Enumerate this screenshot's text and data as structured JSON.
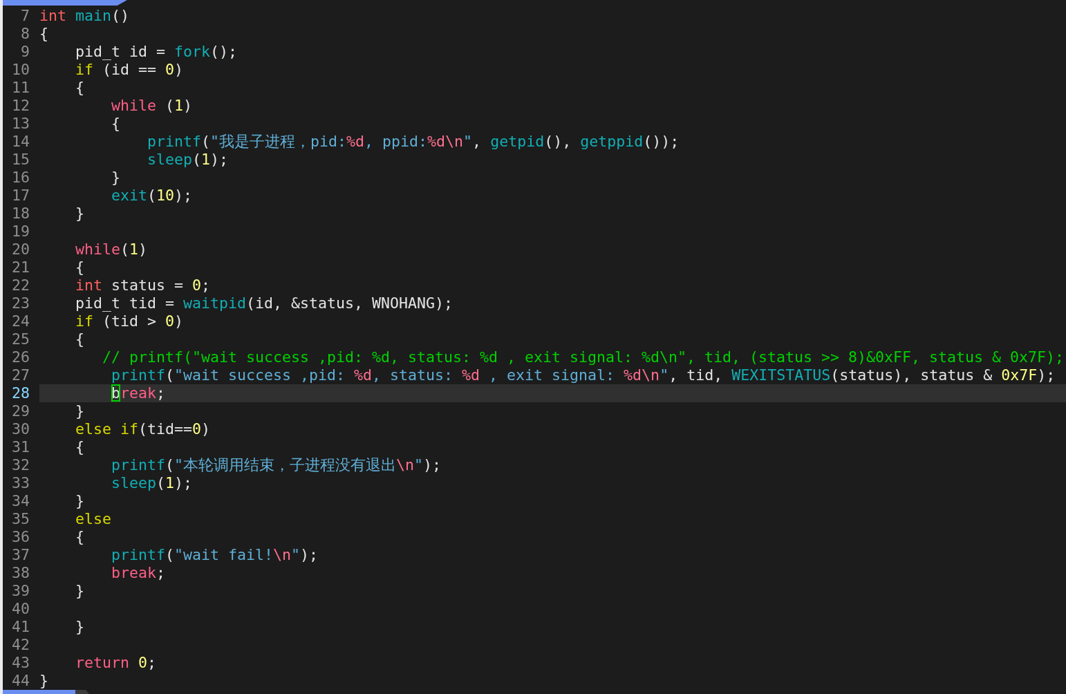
{
  "tabline": {
    "tab": {
      "selected": true
    }
  },
  "lines": [
    {
      "number": "7",
      "current": false,
      "tokens": [
        {
          "kind": "type",
          "text": "int "
        },
        {
          "kind": "func",
          "text": "main"
        },
        {
          "kind": "plain",
          "text": "()"
        }
      ]
    },
    {
      "number": "8",
      "current": false,
      "tokens": [
        {
          "kind": "plain",
          "text": "{"
        }
      ]
    },
    {
      "number": "9",
      "current": false,
      "tokens": [
        {
          "kind": "plain",
          "text": "    pid_t id = "
        },
        {
          "kind": "func",
          "text": "fork"
        },
        {
          "kind": "plain",
          "text": "();"
        }
      ]
    },
    {
      "number": "10",
      "current": false,
      "tokens": [
        {
          "kind": "cond",
          "text": "    if"
        },
        {
          "kind": "plain",
          "text": " (id == "
        },
        {
          "kind": "num",
          "text": "0"
        },
        {
          "kind": "plain",
          "text": ")"
        }
      ]
    },
    {
      "number": "11",
      "current": false,
      "tokens": [
        {
          "kind": "plain",
          "text": "    {"
        }
      ]
    },
    {
      "number": "12",
      "current": false,
      "tokens": [
        {
          "kind": "flow",
          "text": "        while"
        },
        {
          "kind": "plain",
          "text": " ("
        },
        {
          "kind": "num",
          "text": "1"
        },
        {
          "kind": "plain",
          "text": ")"
        }
      ]
    },
    {
      "number": "13",
      "current": false,
      "tokens": [
        {
          "kind": "plain",
          "text": "        {"
        }
      ]
    },
    {
      "number": "14",
      "current": false,
      "tokens": [
        {
          "kind": "func",
          "text": "            printf"
        },
        {
          "kind": "plain",
          "text": "("
        },
        {
          "kind": "str",
          "text": "\"我是子进程，pid:"
        },
        {
          "kind": "fmt",
          "text": "%d"
        },
        {
          "kind": "str",
          "text": ", ppid:"
        },
        {
          "kind": "fmt",
          "text": "%d\\n"
        },
        {
          "kind": "str",
          "text": "\""
        },
        {
          "kind": "plain",
          "text": ", "
        },
        {
          "kind": "func",
          "text": "getpid"
        },
        {
          "kind": "plain",
          "text": "(), "
        },
        {
          "kind": "func",
          "text": "getppid"
        },
        {
          "kind": "plain",
          "text": "());"
        }
      ]
    },
    {
      "number": "15",
      "current": false,
      "tokens": [
        {
          "kind": "func",
          "text": "            sleep"
        },
        {
          "kind": "plain",
          "text": "("
        },
        {
          "kind": "num",
          "text": "1"
        },
        {
          "kind": "plain",
          "text": ");"
        }
      ]
    },
    {
      "number": "16",
      "current": false,
      "tokens": [
        {
          "kind": "plain",
          "text": "        }"
        }
      ]
    },
    {
      "number": "17",
      "current": false,
      "tokens": [
        {
          "kind": "func",
          "text": "        exit"
        },
        {
          "kind": "plain",
          "text": "("
        },
        {
          "kind": "num",
          "text": "10"
        },
        {
          "kind": "plain",
          "text": ");"
        }
      ]
    },
    {
      "number": "18",
      "current": false,
      "tokens": [
        {
          "kind": "plain",
          "text": "    }"
        }
      ]
    },
    {
      "number": "19",
      "current": false
    },
    {
      "number": "20",
      "current": false,
      "tokens": [
        {
          "kind": "flow",
          "text": "    while"
        },
        {
          "kind": "plain",
          "text": "("
        },
        {
          "kind": "num",
          "text": "1"
        },
        {
          "kind": "plain",
          "text": ")"
        }
      ]
    },
    {
      "number": "21",
      "current": false,
      "tokens": [
        {
          "kind": "plain",
          "text": "    {"
        }
      ]
    },
    {
      "number": "22",
      "current": false,
      "tokens": [
        {
          "kind": "type",
          "text": "    int"
        },
        {
          "kind": "plain",
          "text": " status = "
        },
        {
          "kind": "num",
          "text": "0"
        },
        {
          "kind": "plain",
          "text": ";"
        }
      ]
    },
    {
      "number": "23",
      "current": false,
      "tokens": [
        {
          "kind": "plain",
          "text": "    pid_t tid = "
        },
        {
          "kind": "func",
          "text": "waitpid"
        },
        {
          "kind": "plain",
          "text": "(id, &status, WNOHANG);"
        }
      ]
    },
    {
      "number": "24",
      "current": false,
      "tokens": [
        {
          "kind": "cond",
          "text": "    if"
        },
        {
          "kind": "plain",
          "text": " (tid > "
        },
        {
          "kind": "num",
          "text": "0"
        },
        {
          "kind": "plain",
          "text": ")"
        }
      ]
    },
    {
      "number": "25",
      "current": false,
      "tokens": [
        {
          "kind": "plain",
          "text": "    {"
        }
      ]
    },
    {
      "number": "26",
      "current": false,
      "tokens": [
        {
          "kind": "comment",
          "text": "       // printf(\"wait success ,pid: %d, status: %d , exit signal: %d\\n\", tid, (status >> 8)&0xFF, status & 0x7F);"
        }
      ]
    },
    {
      "number": "27",
      "current": false,
      "tokens": [
        {
          "kind": "func",
          "text": "        printf"
        },
        {
          "kind": "plain",
          "text": "("
        },
        {
          "kind": "str",
          "text": "\"wait success ,pid: "
        },
        {
          "kind": "fmt",
          "text": "%d"
        },
        {
          "kind": "str",
          "text": ", status: "
        },
        {
          "kind": "fmt",
          "text": "%d"
        },
        {
          "kind": "str",
          "text": " , exit signal: "
        },
        {
          "kind": "fmt",
          "text": "%d\\n"
        },
        {
          "kind": "str",
          "text": "\""
        },
        {
          "kind": "plain",
          "text": ", tid, "
        },
        {
          "kind": "func",
          "text": "WEXITSTATUS"
        },
        {
          "kind": "plain",
          "text": "(status), status & "
        },
        {
          "kind": "num",
          "text": "0x7F"
        },
        {
          "kind": "plain",
          "text": ");"
        }
      ]
    },
    {
      "number": "28",
      "current": true,
      "tokens": [
        {
          "kind": "cursor",
          "text": "b",
          "indent": true
        },
        {
          "kind": "flow",
          "text": "reak"
        },
        {
          "kind": "plain",
          "text": ";"
        }
      ]
    },
    {
      "number": "29",
      "current": false,
      "tokens": [
        {
          "kind": "plain",
          "text": "    }"
        }
      ]
    },
    {
      "number": "30",
      "current": false,
      "tokens": [
        {
          "kind": "cond",
          "text": "    else if"
        },
        {
          "kind": "plain",
          "text": "(tid=="
        },
        {
          "kind": "num",
          "text": "0"
        },
        {
          "kind": "plain",
          "text": ")"
        }
      ]
    },
    {
      "number": "31",
      "current": false,
      "tokens": [
        {
          "kind": "plain",
          "text": "    {"
        }
      ]
    },
    {
      "number": "32",
      "current": false,
      "tokens": [
        {
          "kind": "func",
          "text": "        printf"
        },
        {
          "kind": "plain",
          "text": "("
        },
        {
          "kind": "str",
          "text": "\"本轮调用结束，子进程没有退出"
        },
        {
          "kind": "fmt",
          "text": "\\n"
        },
        {
          "kind": "str",
          "text": "\""
        },
        {
          "kind": "plain",
          "text": ");"
        }
      ]
    },
    {
      "number": "33",
      "current": false,
      "tokens": [
        {
          "kind": "func",
          "text": "        sleep"
        },
        {
          "kind": "plain",
          "text": "("
        },
        {
          "kind": "num",
          "text": "1"
        },
        {
          "kind": "plain",
          "text": ");"
        }
      ]
    },
    {
      "number": "34",
      "current": false,
      "tokens": [
        {
          "kind": "plain",
          "text": "    }"
        }
      ]
    },
    {
      "number": "35",
      "current": false,
      "tokens": [
        {
          "kind": "cond",
          "text": "    else"
        }
      ]
    },
    {
      "number": "36",
      "current": false,
      "tokens": [
        {
          "kind": "plain",
          "text": "    {"
        }
      ]
    },
    {
      "number": "37",
      "current": false,
      "tokens": [
        {
          "kind": "func",
          "text": "        printf"
        },
        {
          "kind": "plain",
          "text": "("
        },
        {
          "kind": "str",
          "text": "\"wait fail!"
        },
        {
          "kind": "fmt",
          "text": "\\n"
        },
        {
          "kind": "str",
          "text": "\""
        },
        {
          "kind": "plain",
          "text": ");"
        }
      ]
    },
    {
      "number": "38",
      "current": false,
      "tokens": [
        {
          "kind": "flow",
          "text": "        break"
        },
        {
          "kind": "plain",
          "text": ";"
        }
      ]
    },
    {
      "number": "39",
      "current": false,
      "tokens": [
        {
          "kind": "plain",
          "text": "    }"
        }
      ]
    },
    {
      "number": "40",
      "current": false
    },
    {
      "number": "41",
      "current": false,
      "tokens": [
        {
          "kind": "plain",
          "text": "    }"
        }
      ]
    },
    {
      "number": "42",
      "current": false
    },
    {
      "number": "43",
      "current": false,
      "tokens": [
        {
          "kind": "flow",
          "text": "    return "
        },
        {
          "kind": "num",
          "text": "0"
        },
        {
          "kind": "plain",
          "text": ";"
        }
      ]
    },
    {
      "number": "44",
      "current": false,
      "tokens": [
        {
          "kind": "plain",
          "text": "}"
        }
      ]
    }
  ],
  "statusline": {
    "mode": {
      "kind": "normal"
    }
  }
}
